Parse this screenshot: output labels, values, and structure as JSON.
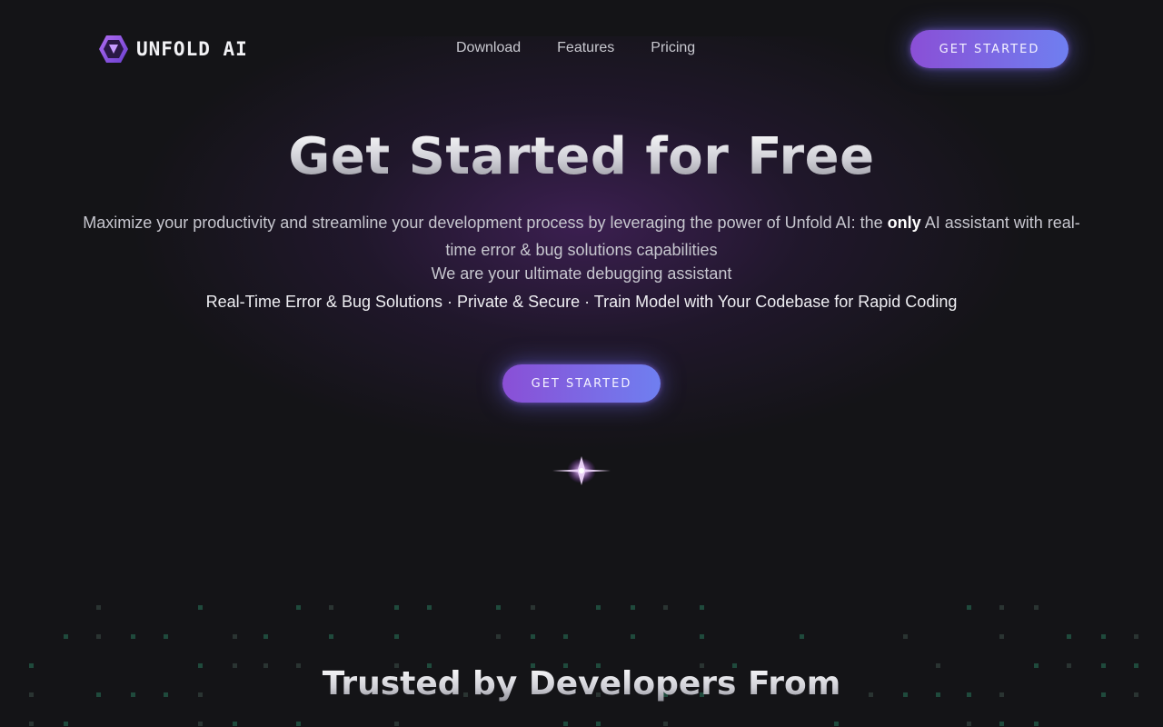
{
  "brand": {
    "name": "UNFOLD AI",
    "accent": "#8a4fd6",
    "accent_end": "#6f7ff0"
  },
  "nav": {
    "items": [
      {
        "label": "Download"
      },
      {
        "label": "Features"
      },
      {
        "label": "Pricing"
      }
    ],
    "cta_label": "GET STARTED"
  },
  "hero": {
    "title": "Get Started for Free",
    "desc_before": "Maximize your productivity and streamline your development process by leveraging the power of Unfold AI: the ",
    "desc_strong": "only",
    "desc_after": " AI assistant with real-time error & bug solutions capabilities",
    "subtitle": "We are your ultimate debugging assistant",
    "features": "Real-Time Error & Bug Solutions · Private & Secure · Train Model with Your Codebase for Rapid Coding",
    "cta_label": "GET STARTED"
  },
  "trusted": {
    "title": "Trusted by Developers From"
  },
  "icons": {
    "logo": "hexagon-logo-icon",
    "sparkle": "sparkle-icon"
  }
}
